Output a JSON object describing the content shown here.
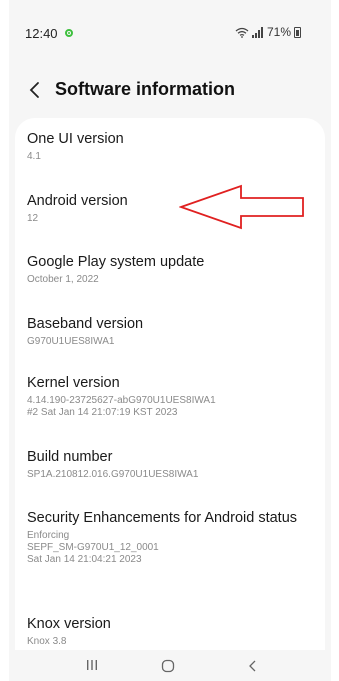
{
  "status": {
    "time": "12:40",
    "battery": "71%"
  },
  "header": {
    "title": "Software information"
  },
  "items": [
    {
      "title": "One UI version",
      "lines": [
        "4.1"
      ]
    },
    {
      "title": "Android version",
      "lines": [
        "12"
      ]
    },
    {
      "title": "Google Play system update",
      "lines": [
        "October 1, 2022"
      ]
    },
    {
      "title": "Baseband version",
      "lines": [
        "G970U1UES8IWA1"
      ]
    },
    {
      "title": "Kernel version",
      "lines": [
        "4.14.190-23725627-abG970U1UES8IWA1",
        "#2 Sat Jan 14 21:07:19 KST 2023"
      ]
    },
    {
      "title": "Build number",
      "lines": [
        "SP1A.210812.016.G970U1UES8IWA1"
      ]
    },
    {
      "title": "Security Enhancements for Android status",
      "lines": [
        "Enforcing",
        "SEPF_SM-G970U1_12_0001",
        "Sat Jan 14 21:04:21 2023"
      ]
    },
    {
      "title": "Knox version",
      "lines": [
        "Knox 3.8"
      ]
    }
  ],
  "colors": {
    "annotation_arrow": "#e02020",
    "status_dot": "#3ec03e"
  }
}
